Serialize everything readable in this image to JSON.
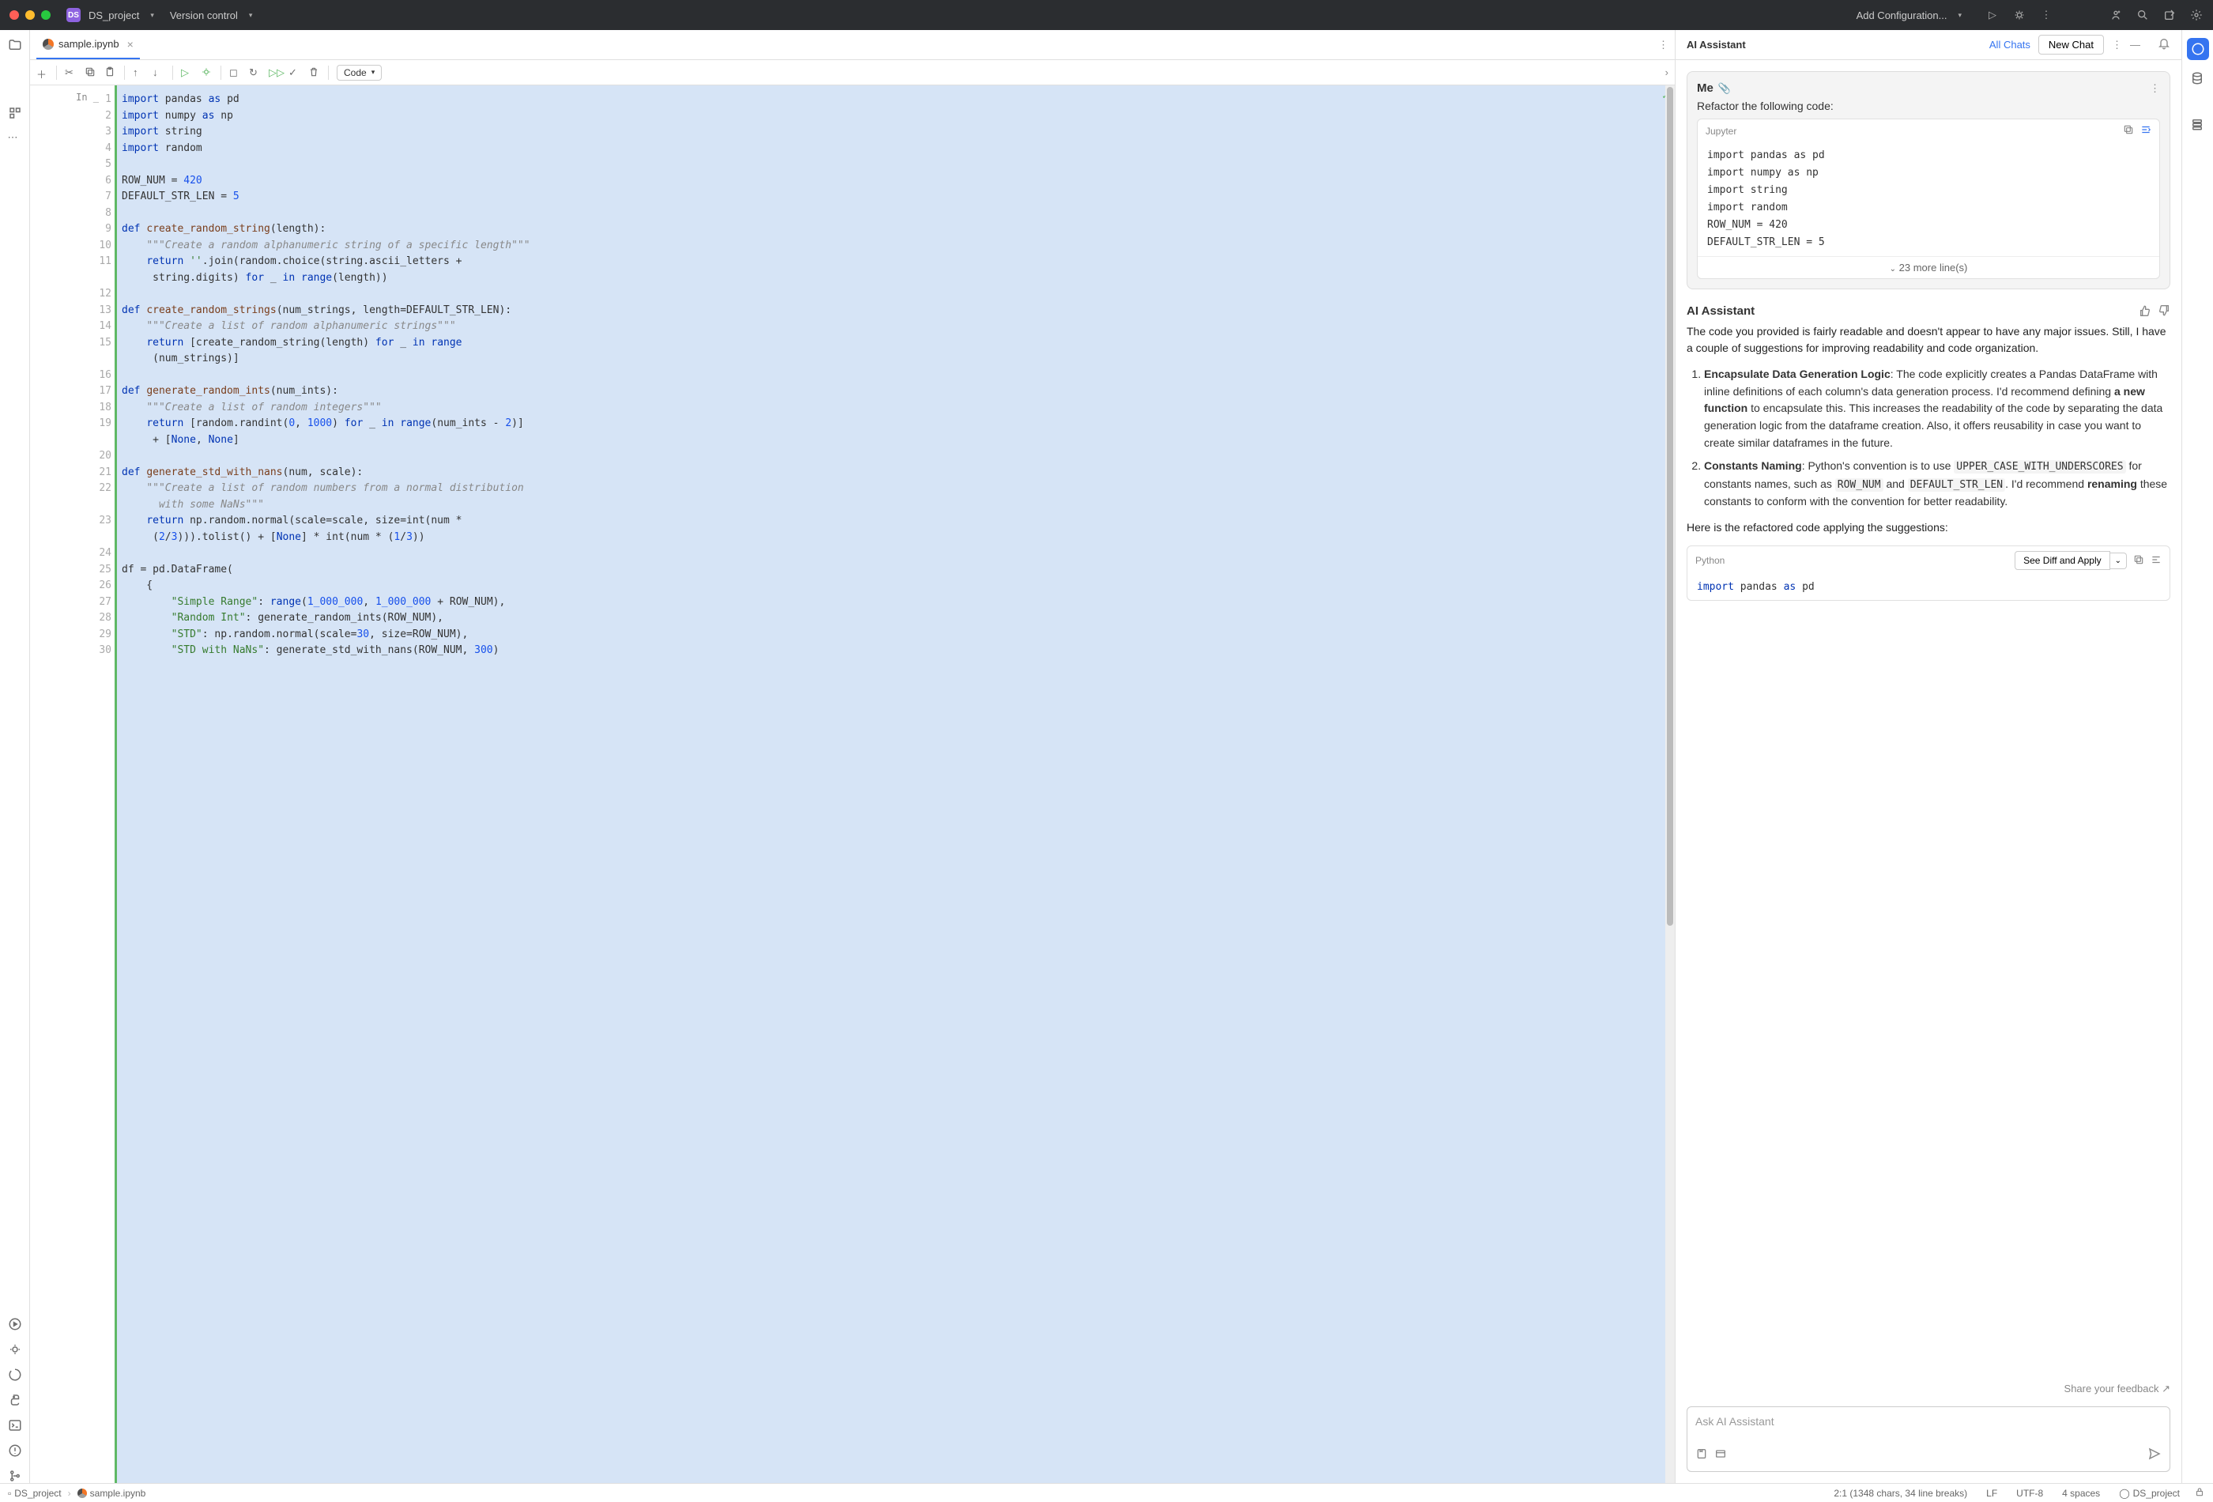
{
  "titlebar": {
    "project_badge": "DS",
    "project_name": "DS_project",
    "vcs_label": "Version control",
    "run_config": "Add Configuration..."
  },
  "tabs": {
    "file": "sample.ipynb"
  },
  "toolbar": {
    "code_label": "Code"
  },
  "cell": {
    "prompt": "In _",
    "line_count": 30
  },
  "code_tokens": [
    [
      [
        "kw",
        "import"
      ],
      [
        "op",
        " pandas "
      ],
      [
        "kw",
        "as"
      ],
      [
        "op",
        " pd"
      ]
    ],
    [
      [
        "kw",
        "import"
      ],
      [
        "op",
        " numpy "
      ],
      [
        "kw",
        "as"
      ],
      [
        "op",
        " np"
      ]
    ],
    [
      [
        "kw",
        "import"
      ],
      [
        "op",
        " string"
      ]
    ],
    [
      [
        "kw",
        "import"
      ],
      [
        "op",
        " random"
      ]
    ],
    [],
    [
      [
        "op",
        "ROW_NUM = "
      ],
      [
        "num",
        "420"
      ]
    ],
    [
      [
        "op",
        "DEFAULT_STR_LEN = "
      ],
      [
        "num",
        "5"
      ]
    ],
    [],
    [
      [
        "kw",
        "def "
      ],
      [
        "fn",
        "create_random_string"
      ],
      [
        "op",
        "(length):"
      ]
    ],
    [
      [
        "op",
        "    "
      ],
      [
        "doc",
        "\"\"\"Create a random alphanumeric string of a specific length\"\"\""
      ]
    ],
    [
      [
        "op",
        "    "
      ],
      [
        "kw",
        "return"
      ],
      [
        "op",
        " "
      ],
      [
        "str",
        "''"
      ],
      [
        "op",
        ".join(random.choice(string.ascii_letters +"
      ]
    ],
    [
      [
        "op",
        "     string.digits) "
      ],
      [
        "kw",
        "for"
      ],
      [
        "op",
        " _ "
      ],
      [
        "kw",
        "in"
      ],
      [
        "op",
        " "
      ],
      [
        "kw",
        "range"
      ],
      [
        "op",
        "(length))"
      ]
    ],
    [],
    [
      [
        "kw",
        "def "
      ],
      [
        "fn",
        "create_random_strings"
      ],
      [
        "op",
        "(num_strings, length=DEFAULT_STR_LEN):"
      ]
    ],
    [
      [
        "op",
        "    "
      ],
      [
        "doc",
        "\"\"\"Create a list of random alphanumeric strings\"\"\""
      ]
    ],
    [
      [
        "op",
        "    "
      ],
      [
        "kw",
        "return"
      ],
      [
        "op",
        " [create_random_string(length) "
      ],
      [
        "kw",
        "for"
      ],
      [
        "op",
        " _ "
      ],
      [
        "kw",
        "in"
      ],
      [
        "op",
        " "
      ],
      [
        "kw",
        "range"
      ]
    ],
    [
      [
        "op",
        "     (num_strings)]"
      ]
    ],
    [],
    [
      [
        "kw",
        "def "
      ],
      [
        "fn",
        "generate_random_ints"
      ],
      [
        "op",
        "(num_ints):"
      ]
    ],
    [
      [
        "op",
        "    "
      ],
      [
        "doc",
        "\"\"\"Create a list of random integers\"\"\""
      ]
    ],
    [
      [
        "op",
        "    "
      ],
      [
        "kw",
        "return"
      ],
      [
        "op",
        " [random.randint("
      ],
      [
        "num",
        "0"
      ],
      [
        "op",
        ", "
      ],
      [
        "num",
        "1000"
      ],
      [
        "op",
        ") "
      ],
      [
        "kw",
        "for"
      ],
      [
        "op",
        " _ "
      ],
      [
        "kw",
        "in"
      ],
      [
        "op",
        " "
      ],
      [
        "kw",
        "range"
      ],
      [
        "op",
        "(num_ints - "
      ],
      [
        "num",
        "2"
      ],
      [
        "op",
        ")]"
      ]
    ],
    [
      [
        "op",
        "     + ["
      ],
      [
        "kw",
        "None"
      ],
      [
        "op",
        ", "
      ],
      [
        "kw",
        "None"
      ],
      [
        "op",
        "]"
      ]
    ],
    [],
    [
      [
        "kw",
        "def "
      ],
      [
        "fn",
        "generate_std_with_nans"
      ],
      [
        "op",
        "(num, scale):"
      ]
    ],
    [
      [
        "op",
        "    "
      ],
      [
        "doc",
        "\"\"\"Create a list of random numbers from a normal distribution"
      ]
    ],
    [
      [
        "doc",
        "      with some NaNs\"\"\""
      ]
    ],
    [
      [
        "op",
        "    "
      ],
      [
        "kw",
        "return"
      ],
      [
        "op",
        " np.random.normal(scale=scale, size=int(num *"
      ]
    ],
    [
      [
        "op",
        "     ("
      ],
      [
        "num",
        "2"
      ],
      [
        "op",
        "/"
      ],
      [
        "num",
        "3"
      ],
      [
        "op",
        "))).tolist() + ["
      ],
      [
        "kw",
        "None"
      ],
      [
        "op",
        "] * int(num * ("
      ],
      [
        "num",
        "1"
      ],
      [
        "op",
        "/"
      ],
      [
        "num",
        "3"
      ],
      [
        "op",
        "))"
      ]
    ],
    [],
    [
      [
        "op",
        "df = pd.DataFrame("
      ]
    ],
    [
      [
        "op",
        "    {"
      ]
    ],
    [
      [
        "op",
        "        "
      ],
      [
        "str",
        "\"Simple Range\""
      ],
      [
        "op",
        ": "
      ],
      [
        "kw",
        "range"
      ],
      [
        "op",
        "("
      ],
      [
        "num",
        "1_000_000"
      ],
      [
        "op",
        ", "
      ],
      [
        "num",
        "1_000_000"
      ],
      [
        "op",
        " + ROW_NUM),"
      ]
    ],
    [
      [
        "op",
        "        "
      ],
      [
        "str",
        "\"Random Int\""
      ],
      [
        "op",
        ": generate_random_ints(ROW_NUM),"
      ]
    ],
    [
      [
        "op",
        "        "
      ],
      [
        "str",
        "\"STD\""
      ],
      [
        "op",
        ": np.random.normal(scale="
      ],
      [
        "num",
        "30"
      ],
      [
        "op",
        ", size=ROW_NUM),"
      ]
    ],
    [
      [
        "op",
        "        "
      ],
      [
        "str",
        "\"STD with NaNs\""
      ],
      [
        "op",
        ": generate_std_with_nans(ROW_NUM, "
      ],
      [
        "num",
        "300"
      ],
      [
        "op",
        ")"
      ]
    ]
  ],
  "visible_line_numbers": [
    "1",
    "2",
    "3",
    "4",
    "5",
    "6",
    "7",
    "8",
    "9",
    "10",
    "11",
    "",
    "12",
    "13",
    "14",
    "15",
    "",
    "16",
    "17",
    "18",
    "19",
    "",
    "20",
    "21",
    "22",
    "",
    "23",
    "",
    "24",
    "25",
    "26",
    "27",
    "28",
    "29",
    "30"
  ],
  "ai": {
    "title": "AI Assistant",
    "all_chats": "All Chats",
    "new_chat": "New Chat",
    "me_label": "Me",
    "me_prompt": "Refactor the following code:",
    "attach_lang": "Jupyter",
    "attach_lines": [
      "import pandas as pd",
      "import numpy as np",
      "import string",
      "import random",
      "ROW_NUM = 420",
      "DEFAULT_STR_LEN = 5"
    ],
    "attach_expand": "23 more line(s)",
    "resp_title": "AI Assistant",
    "resp_intro": "The code you provided is fairly readable and doesn't appear to have any major issues. Still, I have a couple of suggestions for improving readability and code organization.",
    "sugg1_title": "Encapsulate Data Generation Logic",
    "sugg1_body_a": ": The code explicitly creates a Pandas DataFrame with inline definitions of each column's data generation process. I'd recommend defining ",
    "sugg1_bold": "a new function",
    "sugg1_body_b": " to encapsulate this. This increases the readability of the code by separating the data generation logic from the dataframe creation. Also, it offers reusability in case you want to create similar dataframes in the future.",
    "sugg2_title": "Constants Naming",
    "sugg2_body_a": ": Python's convention is to use ",
    "sugg2_mono1": "UPPER_CASE_WITH_UNDERSCORES",
    "sugg2_body_b": " for constants names, such as ",
    "sugg2_mono2": "ROW_NUM",
    "sugg2_body_c": " and ",
    "sugg2_mono3": "DEFAULT_STR_LEN",
    "sugg2_body_d": ". I'd recommend ",
    "sugg2_bold": "renaming",
    "sugg2_body_e": " these constants to conform with the convention for better readability.",
    "resp_outro": "Here is the refactored code applying the suggestions:",
    "out_lang": "Python",
    "see_diff": "See Diff and Apply",
    "out_code": "import pandas as pd",
    "feedback": "Share your feedback ↗",
    "input_placeholder": "Ask AI Assistant"
  },
  "statusbar": {
    "crumb_project": "DS_project",
    "crumb_file": "sample.ipynb",
    "pos": "2:1 (1348 chars, 34 line breaks)",
    "le": "LF",
    "enc": "UTF-8",
    "indent": "4 spaces",
    "interp": "DS_project"
  }
}
